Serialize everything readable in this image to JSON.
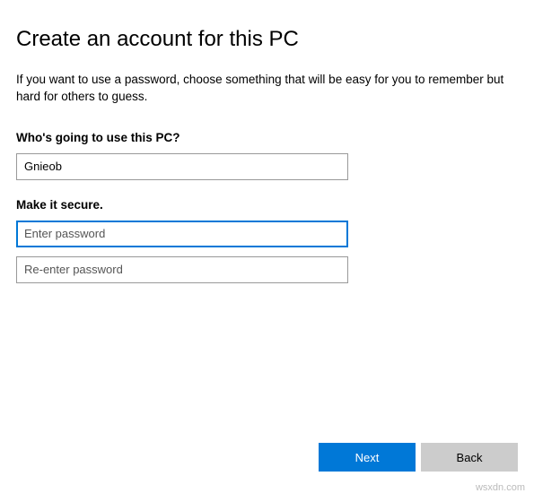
{
  "header": {
    "title": "Create an account for this PC",
    "subtitle": "If you want to use a password, choose something that will be easy for you to remember but hard for others to guess."
  },
  "sections": {
    "who": {
      "label": "Who's going to use this PC?",
      "username_value": "Gnieob"
    },
    "secure": {
      "label": "Make it secure.",
      "password_placeholder": "Enter password",
      "confirm_placeholder": "Re-enter password"
    }
  },
  "footer": {
    "next_label": "Next",
    "back_label": "Back"
  },
  "watermark": "wsxdn.com"
}
